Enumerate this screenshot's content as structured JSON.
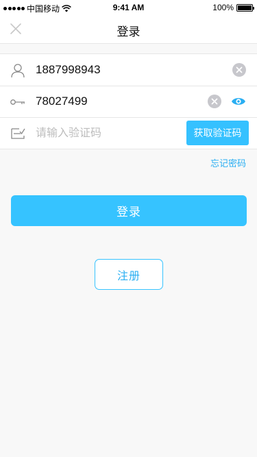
{
  "status_bar": {
    "carrier": "中国移动",
    "time": "9:41 AM",
    "battery": "100%"
  },
  "nav": {
    "title": "登录",
    "close_icon": "close-icon"
  },
  "form": {
    "phone": {
      "value": "1887998943",
      "icon": "user-icon"
    },
    "password": {
      "value": "78027499",
      "icon": "key-icon"
    },
    "code": {
      "value": "",
      "placeholder": "请输入验证码",
      "icon": "sms-code-icon",
      "button_label": "获取验证码"
    }
  },
  "links": {
    "forgot_password": "忘记密码"
  },
  "actions": {
    "login_label": "登录",
    "register_label": "注册"
  },
  "colors": {
    "accent": "#36c3ff",
    "link": "#29aef2",
    "background": "#f8f8f8"
  }
}
